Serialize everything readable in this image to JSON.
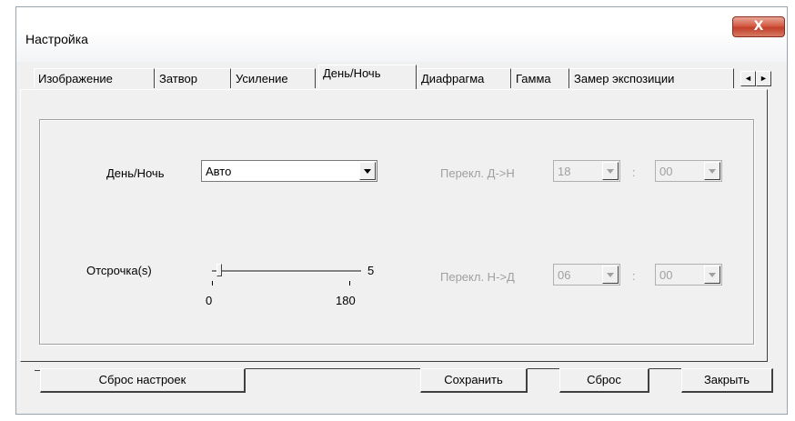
{
  "window": {
    "title": "Настройка",
    "close_glyph": "X"
  },
  "tabs": [
    {
      "label": "Изображение"
    },
    {
      "label": "Затвор"
    },
    {
      "label": "Усиление"
    },
    {
      "label": "День/Ночь",
      "active": true
    },
    {
      "label": "Диафрагма"
    },
    {
      "label": "Гамма"
    },
    {
      "label": "Замер экспозиции"
    }
  ],
  "tab_scroll": {
    "left": "◄",
    "right": "►"
  },
  "daynight": {
    "label": "День/Ночь",
    "value": "Авто",
    "switch_dn_label": "Перекл. Д->Н",
    "switch_dn_hour": "18",
    "switch_dn_min": "00",
    "switch_nd_label": "Перекл. Н->Д",
    "switch_nd_hour": "06",
    "switch_nd_min": "00",
    "colon": ":"
  },
  "delay": {
    "label": "Отсрочка(s)",
    "value": "5",
    "min": "0",
    "max": "180",
    "level": 0.03
  },
  "buttons": {
    "reset_settings": "Сброс настроек",
    "save": "Сохранить",
    "reset": "Сброс",
    "close": "Закрыть"
  }
}
